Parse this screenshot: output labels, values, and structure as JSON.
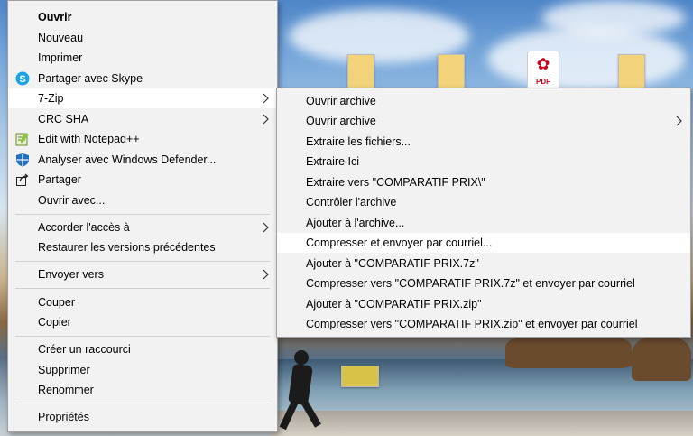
{
  "main_menu": {
    "items": [
      {
        "label": "Ouvrir"
      },
      {
        "label": "Nouveau"
      },
      {
        "label": "Imprimer"
      },
      {
        "label": "Partager avec Skype",
        "icon": "skype-icon"
      },
      {
        "label": "7-Zip",
        "has_submenu": true
      },
      {
        "label": "CRC SHA",
        "has_submenu": true
      },
      {
        "label": "Edit with Notepad++",
        "icon": "notepad-plus-plus-icon"
      },
      {
        "label": "Analyser avec Windows Defender...",
        "icon": "windows-defender-icon"
      },
      {
        "label": "Partager",
        "icon": "share-icon"
      },
      {
        "label": "Ouvrir avec..."
      },
      {
        "label": "Accorder l'accès à",
        "has_submenu": true
      },
      {
        "label": "Restaurer les versions précédentes"
      },
      {
        "label": "Envoyer vers",
        "has_submenu": true
      },
      {
        "label": "Couper"
      },
      {
        "label": "Copier"
      },
      {
        "label": "Créer un raccourci"
      },
      {
        "label": "Supprimer"
      },
      {
        "label": "Renommer"
      },
      {
        "label": "Propriétés"
      }
    ]
  },
  "submenu_7zip": {
    "items": [
      {
        "label": "Ouvrir archive"
      },
      {
        "label": "Ouvrir archive",
        "has_submenu": true
      },
      {
        "label": "Extraire les fichiers..."
      },
      {
        "label": "Extraire Ici"
      },
      {
        "label": "Extraire vers \"COMPARATIF PRIX\\\""
      },
      {
        "label": "Contrôler l'archive"
      },
      {
        "label": "Ajouter à l'archive..."
      },
      {
        "label": "Compresser et envoyer par courriel..."
      },
      {
        "label": "Ajouter à \"COMPARATIF PRIX.7z\""
      },
      {
        "label": "Compresser vers \"COMPARATIF PRIX.7z\" et envoyer par courriel"
      },
      {
        "label": "Ajouter à \"COMPARATIF PRIX.zip\""
      },
      {
        "label": "Compresser vers \"COMPARATIF PRIX.zip\" et envoyer par courriel"
      }
    ]
  },
  "desktop": {
    "pdf_tag": "PDF"
  },
  "colors": {
    "menu_bg": "#f2f2f2",
    "highlight": "#ffffff",
    "separator": "#cfcfcf",
    "pdf_red": "#d0021b"
  }
}
